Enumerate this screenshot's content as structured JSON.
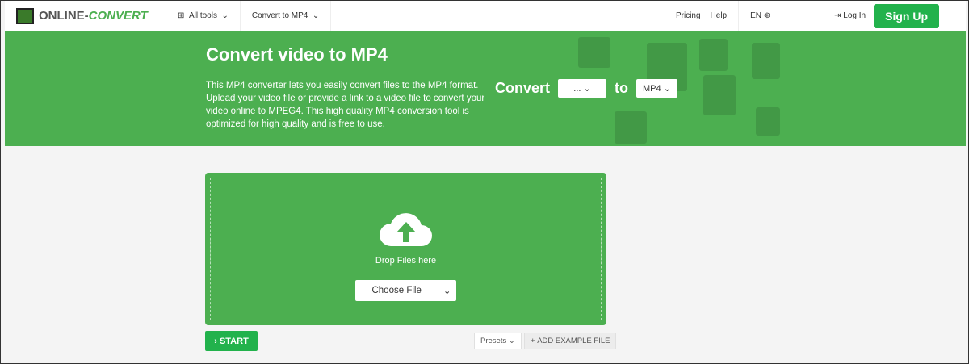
{
  "nav": {
    "logo": "ONLINE-",
    "logo_accent": "CONVERT",
    "all_tools": "All tools",
    "convert_to": "Convert to MP4",
    "pricing": "Pricing",
    "help": "Help",
    "lang": "EN",
    "login": "Log In",
    "signup": "Sign Up"
  },
  "hero": {
    "title": "Convert video to MP4",
    "description": "This MP4 converter lets you easily convert files to the MP4 format. Upload your video file or provide a link to a video file to convert your video online to MPEG4. This high quality MP4 conversion tool is optimized for high quality and is free to use.",
    "convert_label": "Convert",
    "from_value": "...",
    "to_label": "to",
    "to_value": "MP4"
  },
  "upload": {
    "drop_text": "Drop Files here",
    "choose_file": "Choose File"
  },
  "actions": {
    "start": "START",
    "presets": "Presets",
    "add_example": "ADD EXAMPLE FILE"
  }
}
